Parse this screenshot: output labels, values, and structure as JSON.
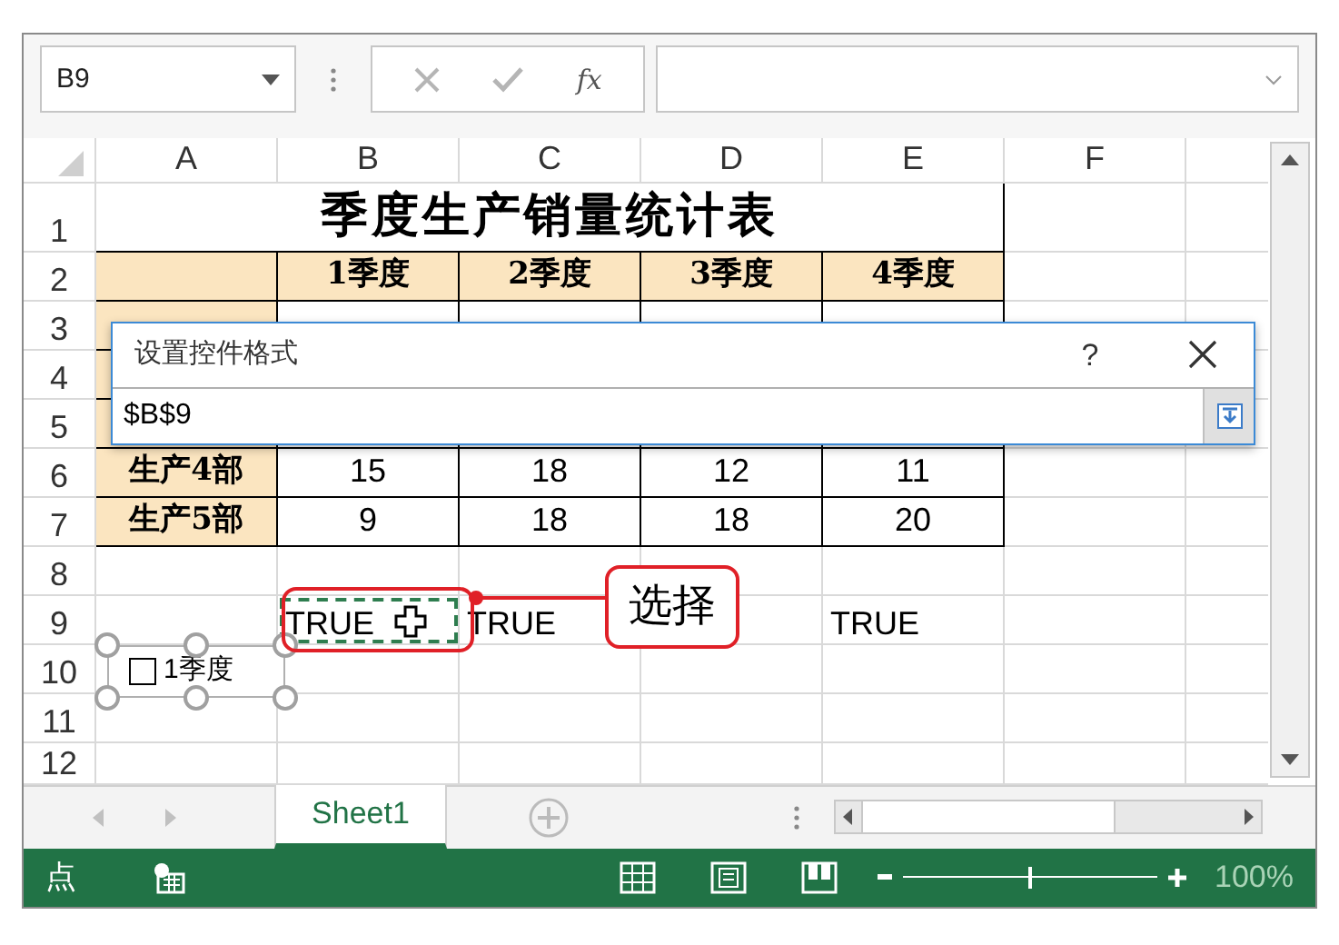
{
  "name_box": {
    "value": "B9"
  },
  "formula_bar": {
    "function_label": "fx"
  },
  "columns": [
    "A",
    "B",
    "C",
    "D",
    "E",
    "F"
  ],
  "rows": [
    {
      "number": "1",
      "cells": [
        {
          "kind": "title",
          "text": "季度生产销量统计表"
        },
        {
          "kind": "blank"
        }
      ]
    },
    {
      "number": "2",
      "cells": [
        {
          "kind": "header"
        },
        {
          "kind": "header",
          "text": "1季度"
        },
        {
          "kind": "header",
          "text": "2季度"
        },
        {
          "kind": "header",
          "text": "3季度"
        },
        {
          "kind": "header",
          "text": "4季度"
        },
        {
          "kind": "blank"
        }
      ]
    },
    {
      "number": "3",
      "cells": [
        {
          "kind": "label"
        },
        {
          "kind": "number"
        },
        {
          "kind": "number"
        },
        {
          "kind": "number"
        },
        {
          "kind": "number"
        },
        {
          "kind": "blank"
        }
      ]
    },
    {
      "number": "4",
      "cells": [
        {
          "kind": "label"
        },
        {
          "kind": "number"
        },
        {
          "kind": "number"
        },
        {
          "kind": "number"
        },
        {
          "kind": "number"
        },
        {
          "kind": "blank"
        }
      ]
    },
    {
      "number": "5",
      "cells": [
        {
          "kind": "label"
        },
        {
          "kind": "number"
        },
        {
          "kind": "number"
        },
        {
          "kind": "number"
        },
        {
          "kind": "number"
        },
        {
          "kind": "blank"
        }
      ]
    },
    {
      "number": "6",
      "cells": [
        {
          "kind": "label",
          "text": "生产4部"
        },
        {
          "kind": "number",
          "text": "15"
        },
        {
          "kind": "number",
          "text": "18"
        },
        {
          "kind": "number",
          "text": "12"
        },
        {
          "kind": "number",
          "text": "11"
        },
        {
          "kind": "blank"
        }
      ]
    },
    {
      "number": "7",
      "cells": [
        {
          "kind": "label",
          "text": "生产5部"
        },
        {
          "kind": "number",
          "text": "9"
        },
        {
          "kind": "number",
          "text": "18"
        },
        {
          "kind": "number",
          "text": "18"
        },
        {
          "kind": "number",
          "text": "20"
        },
        {
          "kind": "blank"
        }
      ]
    },
    {
      "number": "8",
      "cells": []
    },
    {
      "number": "9",
      "cells": [
        {
          "kind": "blank"
        },
        {
          "kind": "value",
          "text": "TRUE",
          "selected": true
        },
        {
          "kind": "value",
          "text": "TRUE",
          "selected": false
        },
        {
          "kind": "blank"
        },
        {
          "kind": "value",
          "text": "TRUE",
          "selected": false
        },
        {
          "kind": "blank"
        }
      ]
    },
    {
      "number": "10",
      "cells": []
    },
    {
      "number": "11",
      "cells": []
    },
    {
      "number": "12",
      "cells": []
    }
  ],
  "checkbox_control": {
    "label": "1季度",
    "checked": false
  },
  "callout": {
    "text": "选择"
  },
  "dialog": {
    "title": "设置控件格式",
    "help": "?",
    "value": "$B$9"
  },
  "sheet_tabs": [
    {
      "label": "Sheet1",
      "selected": true
    }
  ],
  "status_bar": {
    "mode": "点",
    "zoom": "100%",
    "zoom_level": {
      "level": 0.5
    }
  }
}
